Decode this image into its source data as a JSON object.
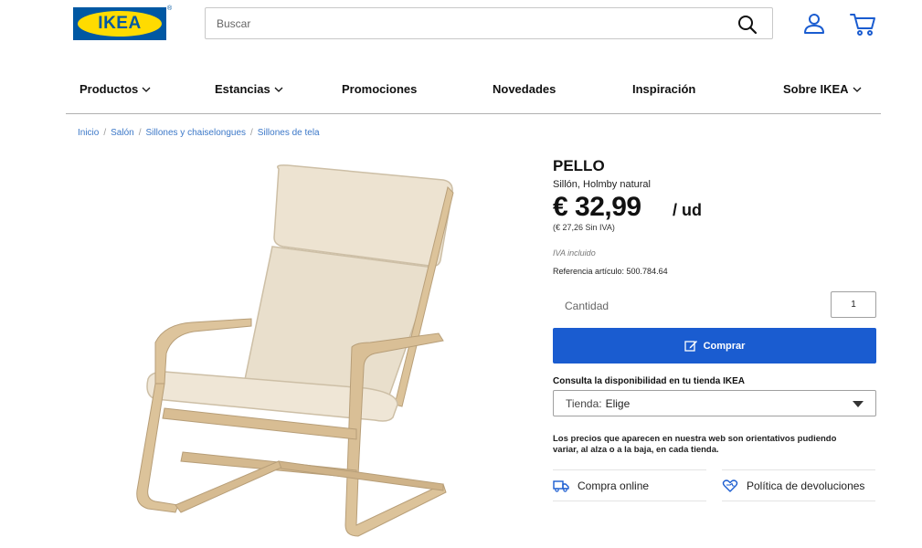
{
  "header": {
    "logo_text": "IKEA",
    "logo_reg": "®",
    "search_placeholder": "Buscar",
    "icons": [
      "search-icon",
      "user-icon",
      "cart-icon"
    ]
  },
  "nav": {
    "items": [
      {
        "label": "Productos",
        "has_dropdown": true
      },
      {
        "label": "Estancias",
        "has_dropdown": true
      },
      {
        "label": "Promociones",
        "has_dropdown": false
      },
      {
        "label": "Novedades",
        "has_dropdown": false
      },
      {
        "label": "Inspiración",
        "has_dropdown": false
      },
      {
        "label": "Sobre IKEA",
        "has_dropdown": true
      }
    ]
  },
  "breadcrumb": {
    "items": [
      "Inicio",
      "Salón",
      "Sillones y chaiselongues",
      "Sillones de tela"
    ],
    "separator": "/"
  },
  "product": {
    "name": "PELLO",
    "description": "Sillón, Holmby natural",
    "price": "€ 32,99",
    "unit": "/ ud",
    "price_no_vat": "(€ 27,26 Sin IVA)",
    "vat_note": "IVA incluido",
    "reference": "Referencia artículo: 500.784.64"
  },
  "purchase": {
    "quantity_label": "Cantidad",
    "quantity_value": "1",
    "buy_label": "Comprar"
  },
  "store": {
    "title": "Consulta la disponibilidad en tu tienda IKEA",
    "select_label": "Tienda:",
    "select_value": "Elige"
  },
  "disclaimer": "Los precios que aparecen en nuestra web son orientativos pudiendo variar, al alza o a la baja, en cada tienda.",
  "features": [
    {
      "label": "Compra online",
      "icon": "truck-icon"
    },
    {
      "label": "Política de devoluciones",
      "icon": "heart-return-icon"
    }
  ],
  "colors": {
    "brand_blue": "#0058a3",
    "brand_yellow": "#ffdb00",
    "button_blue": "#1a5cd0",
    "link_blue": "#3c78c8"
  }
}
